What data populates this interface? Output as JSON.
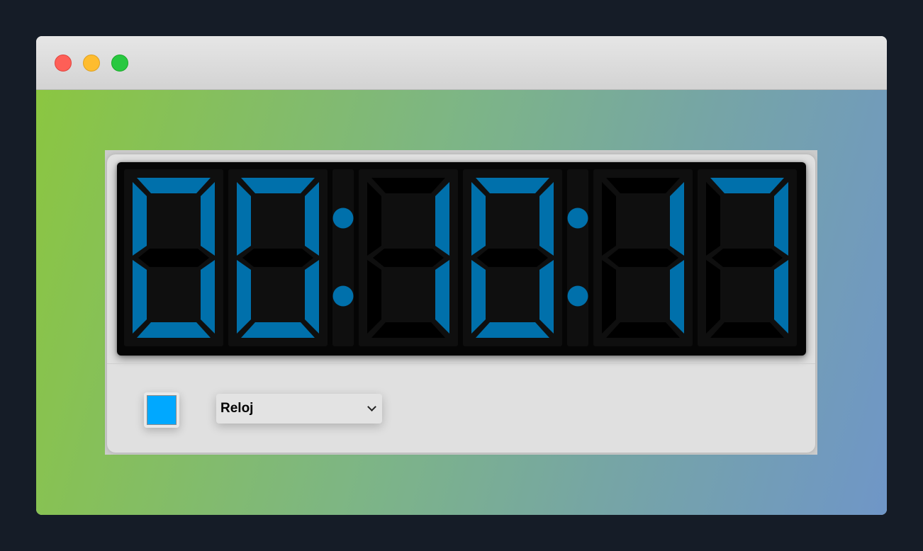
{
  "window": {
    "controls": [
      "close",
      "minimize",
      "maximize"
    ]
  },
  "clock": {
    "display_text": "00:10:17",
    "hours": "00",
    "minutes": "10",
    "seconds": "17",
    "segment_color": "#0070ab",
    "off_segment_color": "#000000"
  },
  "controls": {
    "color_picker_value": "#00a8ff",
    "mode_select": {
      "selected": "Reloj"
    }
  },
  "colors": {
    "background": "#151c27",
    "gradient_start": "#8bc641",
    "gradient_end": "#6f96c7"
  }
}
